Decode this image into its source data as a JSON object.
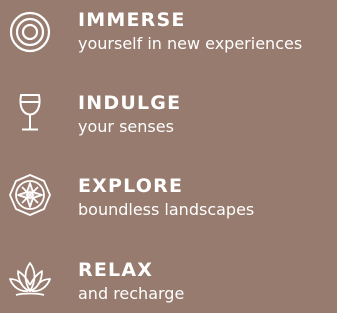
{
  "items": [
    {
      "title": "IMMERSE",
      "subtitle": "yourself in new experiences",
      "icon": "concentric-circles-icon"
    },
    {
      "title": "INDULGE",
      "subtitle": "your senses",
      "icon": "wine-glass-icon"
    },
    {
      "title": "EXPLORE",
      "subtitle": "boundless landscapes",
      "icon": "compass-icon"
    },
    {
      "title": "RELAX",
      "subtitle": "and recharge",
      "icon": "lotus-icon"
    }
  ],
  "colors": {
    "background": "#977b6e",
    "text": "#ffffff"
  }
}
